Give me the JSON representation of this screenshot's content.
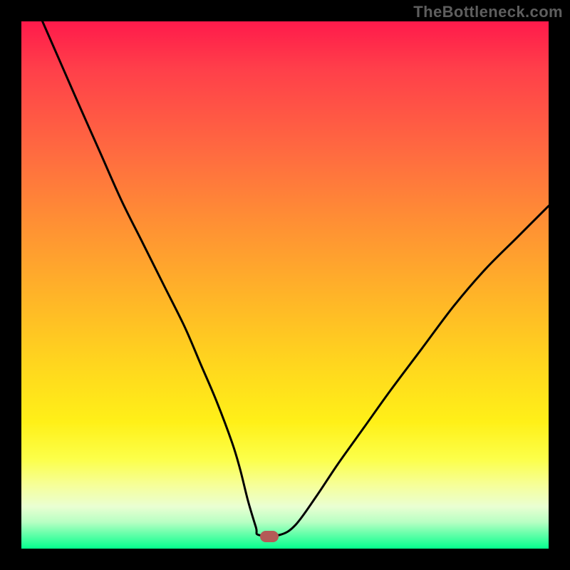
{
  "watermark": "TheBottleneck.com",
  "chart_data": {
    "type": "line",
    "title": "",
    "xlabel": "",
    "ylabel": "",
    "xlim": [
      0,
      100
    ],
    "ylim": [
      0,
      100
    ],
    "series": [
      {
        "name": "curve",
        "x": [
          4,
          7.5,
          11,
          15,
          19,
          23,
          27,
          31,
          34,
          37,
          40,
          41.5,
          43,
          44.5,
          45,
          49,
          52,
          56,
          60,
          65,
          70,
          76,
          82,
          88,
          94,
          100
        ],
        "values": [
          100,
          92,
          84,
          75,
          66,
          58,
          50,
          42,
          35,
          28,
          20,
          15,
          9,
          4,
          2.6,
          2.6,
          4.5,
          10,
          16,
          23,
          30,
          38,
          46,
          53,
          59,
          65
        ]
      }
    ],
    "marker": {
      "x": 47,
      "y": 2.3
    },
    "colors": {
      "curve": "#000000",
      "marker": "#b45a57",
      "gradient_top": "#ff1a4b",
      "gradient_bottom": "#05ff8e",
      "border": "#000000"
    }
  }
}
